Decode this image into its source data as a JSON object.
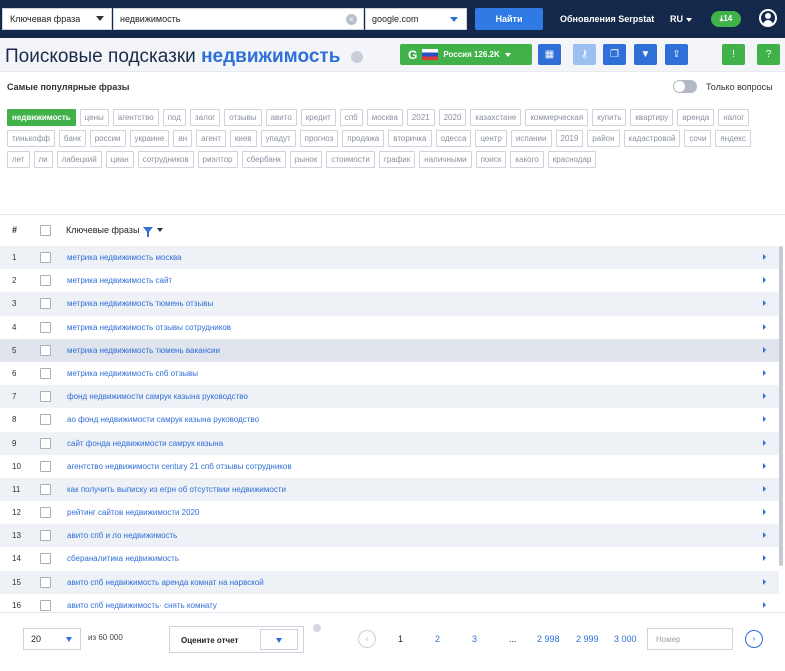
{
  "topbar": {
    "search_type": "Ключевая фраза",
    "query": "недвижимость",
    "engine": "google.com",
    "find_label": "Найти",
    "updates_label": "Обновления Serpstat",
    "lang_label": "RU",
    "credits": "14"
  },
  "header": {
    "title": "Поисковые подсказки",
    "keyword": "недвижимость",
    "region_label": "Россия 126.2K"
  },
  "filters": {
    "popular_label": "Самые популярные фразы",
    "only_questions_label": "Только вопросы",
    "tags": [
      "недвижимость",
      "цены",
      "агентство",
      "под",
      "залог",
      "отзывы",
      "авито",
      "кредит",
      "спб",
      "москва",
      "2021",
      "2020",
      "казахстане",
      "коммерческая",
      "купить",
      "квартиру",
      "аренда",
      "налог",
      "тинькофф",
      "банк",
      "россии",
      "украине",
      "ан",
      "агент",
      "киев",
      "упадут",
      "прогноз",
      "продажа",
      "вторичка",
      "одесса",
      "центр",
      "испании",
      "2019",
      "район",
      "кадастровой",
      "сочи",
      "яндекс",
      "лет",
      "ли",
      "лабецкий",
      "циан",
      "сотрудников",
      "риэлтор",
      "сбербанк",
      "рынок",
      "стоимости",
      "график",
      "наличными",
      "поиск",
      "какого",
      "краснодар"
    ]
  },
  "table": {
    "col_num": "#",
    "col_keywords": "Ключевые фразы",
    "rows": [
      {
        "n": "1",
        "kw": "метрика недвижимость москва"
      },
      {
        "n": "2",
        "kw": "метрика недвижимость сайт"
      },
      {
        "n": "3",
        "kw": "метрика недвижимость тюмень отзывы"
      },
      {
        "n": "4",
        "kw": "метрика недвижимость отзывы сотрудников"
      },
      {
        "n": "5",
        "kw": "метрика недвижимость тюмень вакансии"
      },
      {
        "n": "6",
        "kw": "метрика недвижимость спб отзывы"
      },
      {
        "n": "7",
        "kw": "фонд недвижимости самрук казына руководство"
      },
      {
        "n": "8",
        "kw": "ао фонд недвижимости самрук казына руководство"
      },
      {
        "n": "9",
        "kw": "сайт фонда недвижимости самрук казына"
      },
      {
        "n": "10",
        "kw": "агентство недвижимости century 21 спб отзывы сотрудников"
      },
      {
        "n": "11",
        "kw": "как получить выписку из егрн об отсутствии недвижимости"
      },
      {
        "n": "12",
        "kw": "рейтинг сайтов недвижимости 2020"
      },
      {
        "n": "13",
        "kw": "авито спб и ло недвижимость"
      },
      {
        "n": "14",
        "kw": "сбераналитика недвижимость"
      },
      {
        "n": "15",
        "kw": "авито спб недвижимость аренда комнат на нарвской"
      },
      {
        "n": "16",
        "kw": "авито спб недвижимость· снять комнату"
      }
    ]
  },
  "footer": {
    "per_page": "20",
    "of_total": "из 60 000",
    "rate_label": "Оцените отчет",
    "pages": [
      "1",
      "2",
      "3",
      "...",
      "2 998",
      "2 999",
      "3 000"
    ],
    "goto_placeholder": "Номер"
  },
  "colors": {
    "navy": "#13284a",
    "blue": "#2f6fd8",
    "green": "#41b24a"
  }
}
